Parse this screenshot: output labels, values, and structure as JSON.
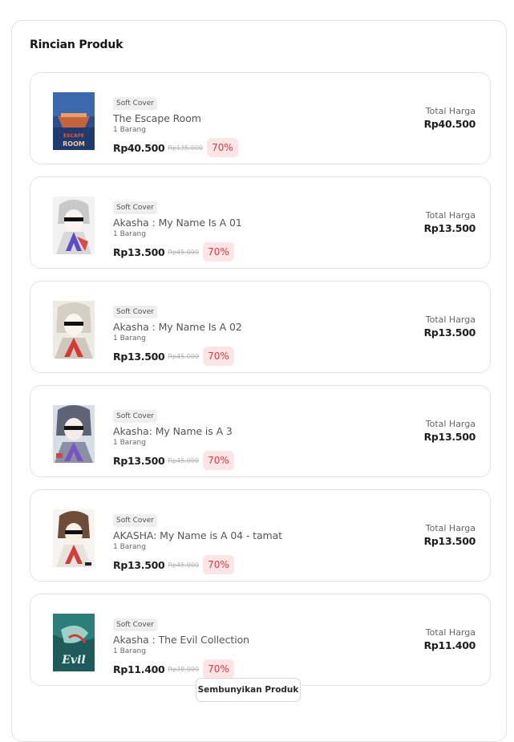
{
  "section": {
    "title": "Rincian Produk",
    "hide_button_label": "Sembunyikan Produk"
  },
  "colors": {
    "discount_bg": "#fde5e6",
    "discount_text": "#d43b4a",
    "border": "#e3e3e3"
  },
  "products": [
    {
      "badge": "Soft Cover",
      "title": "The Escape Room",
      "qty": "1 Barang",
      "price": "Rp40.500",
      "original_price": "Rp135.000",
      "discount": "70%",
      "total_label": "Total Harga",
      "total": "Rp40.500",
      "cover_text": "THE ESCAPE ROOM"
    },
    {
      "badge": "Soft Cover",
      "title": "Akasha : My Name Is A 01",
      "qty": "1 Barang",
      "price": "Rp13.500",
      "original_price": "Rp45.000",
      "discount": "70%",
      "total_label": "Total Harga",
      "total": "Rp13.500"
    },
    {
      "badge": "Soft Cover",
      "title": "Akasha : My Name Is A 02",
      "qty": "1 Barang",
      "price": "Rp13.500",
      "original_price": "Rp45.000",
      "discount": "70%",
      "total_label": "Total Harga",
      "total": "Rp13.500"
    },
    {
      "badge": "Soft Cover",
      "title": "Akasha: My Name is A 3",
      "qty": "1 Barang",
      "price": "Rp13.500",
      "original_price": "Rp45.000",
      "discount": "70%",
      "total_label": "Total Harga",
      "total": "Rp13.500"
    },
    {
      "badge": "Soft Cover",
      "title": "AKASHA: My Name is A 04 - tamat",
      "qty": "1 Barang",
      "price": "Rp13.500",
      "original_price": "Rp45.000",
      "discount": "70%",
      "total_label": "Total Harga",
      "total": "Rp13.500"
    },
    {
      "badge": "Soft Cover",
      "title": "Akasha : The Evil Collection",
      "qty": "1 Barang",
      "price": "Rp11.400",
      "original_price": "Rp38.000",
      "discount": "70%",
      "total_label": "Total Harga",
      "total": "Rp11.400",
      "cover_text": "The Evil"
    }
  ]
}
